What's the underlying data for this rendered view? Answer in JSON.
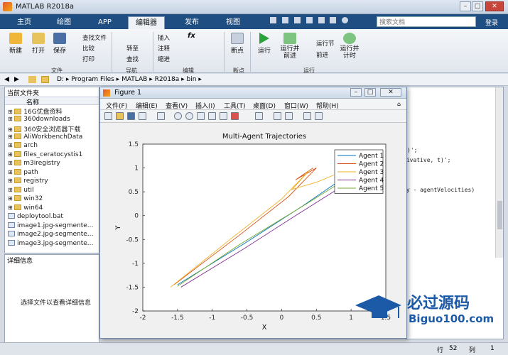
{
  "window": {
    "title": "MATLAB R2018a"
  },
  "tabs": [
    "主页",
    "绘图",
    "APP",
    "编辑器",
    "发布",
    "视图"
  ],
  "active_tab": "编辑器",
  "search": {
    "placeholder": "搜索文档",
    "login": "登录"
  },
  "ribbon": {
    "file": {
      "new": "新建",
      "open": "打开",
      "save": "保存",
      "find_files": "查找文件",
      "compare": "比较",
      "print": "打印",
      "group": "文件"
    },
    "navigate": {
      "goto": "转至",
      "find": "查找",
      "group": "导航"
    },
    "edit": {
      "insert": "插入",
      "comment": "注释",
      "indent": "缩进",
      "group": "编辑"
    },
    "breakpoints": {
      "label": "断点",
      "group": "断点"
    },
    "run": {
      "run": "运行",
      "run_advance": "运行并\n前进",
      "run_section": "运行节",
      "advance": "前进",
      "run_time": "运行并\n计时",
      "group": "运行"
    }
  },
  "address": {
    "segments": [
      "D:",
      "Program Files",
      "MATLAB",
      "R2018a",
      "bin"
    ]
  },
  "current_folder": {
    "title": "当前文件夹",
    "header": "名称",
    "items": [
      {
        "name": "16G优盘资料",
        "type": "folder"
      },
      {
        "name": "360downloads",
        "type": "folder"
      },
      {
        "name": "360安全浏览器下载",
        "type": "folder"
      },
      {
        "name": "AliWorkbenchData",
        "type": "folder"
      },
      {
        "name": "arch",
        "type": "folder"
      },
      {
        "name": "files_ceratocystis1",
        "type": "folder"
      },
      {
        "name": "m3iregistry",
        "type": "folder"
      },
      {
        "name": "path",
        "type": "folder"
      },
      {
        "name": "registry",
        "type": "folder"
      },
      {
        "name": "util",
        "type": "folder"
      },
      {
        "name": "win32",
        "type": "folder"
      },
      {
        "name": "win64",
        "type": "folder"
      },
      {
        "name": "deploytool.bat",
        "type": "file"
      },
      {
        "name": "image1.jpg-segmente...",
        "type": "file"
      },
      {
        "name": "image2.jpg-segmente...",
        "type": "file"
      },
      {
        "name": "image3.jpg-segmente...",
        "type": "file"
      }
    ]
  },
  "details": {
    "title": "详细信息",
    "empty_text": "选择文件以查看详细信息"
  },
  "editor": {
    "lines": [
      ")';",
      "rivative, t)';",
      "ty - agentVelocities)"
    ]
  },
  "statusbar": {
    "row_label": "行",
    "row": "52",
    "col_label": "列",
    "col": "1"
  },
  "figure": {
    "title": "Figure 1",
    "menu": [
      "文件(F)",
      "编辑(E)",
      "查看(V)",
      "插入(I)",
      "工具(T)",
      "桌面(D)",
      "窗口(W)",
      "帮助(H)"
    ]
  },
  "watermark": {
    "text_cn": "必过源码",
    "text_en": "Biguo100.com"
  },
  "chart_data": {
    "type": "line",
    "title": "Multi-Agent Trajectories",
    "xlabel": "X",
    "ylabel": "Y",
    "xlim": [
      -2,
      1.5
    ],
    "ylim": [
      -2,
      1.5
    ],
    "xticks": [
      -2,
      -1.5,
      -1,
      -0.5,
      0,
      0.5,
      1,
      1.5
    ],
    "yticks": [
      -2,
      -1.5,
      -1,
      -0.5,
      0,
      0.5,
      1,
      1.5
    ],
    "legend_position": "top-right",
    "series": [
      {
        "name": "Agent 1",
        "color": "#0072BD",
        "x": [
          -1.5,
          -0.5,
          0.3,
          0.85
        ],
        "y": [
          -1.45,
          -0.55,
          0.2,
          0.75
        ]
      },
      {
        "name": "Agent 2",
        "color": "#D95319",
        "x": [
          -1.55,
          -0.6,
          0.1,
          0.5,
          0.2,
          0.45
        ],
        "y": [
          -1.45,
          -0.4,
          0.4,
          1.0,
          0.75,
          1.0
        ]
      },
      {
        "name": "Agent 3",
        "color": "#EDB120",
        "x": [
          -1.6,
          -0.7,
          0.0,
          0.4,
          0.15,
          0.5,
          0.75
        ],
        "y": [
          -1.5,
          -0.45,
          0.35,
          0.95,
          0.55,
          0.7,
          0.85
        ]
      },
      {
        "name": "Agent 4",
        "color": "#7E2F8E",
        "x": [
          -1.45,
          -0.55,
          0.2,
          0.8
        ],
        "y": [
          -1.5,
          -0.7,
          0.0,
          0.55
        ]
      },
      {
        "name": "Agent 5",
        "color": "#77AC30",
        "x": [
          -1.5,
          -0.6,
          0.25,
          0.8
        ],
        "y": [
          -1.48,
          -0.6,
          0.15,
          0.65
        ]
      }
    ]
  }
}
